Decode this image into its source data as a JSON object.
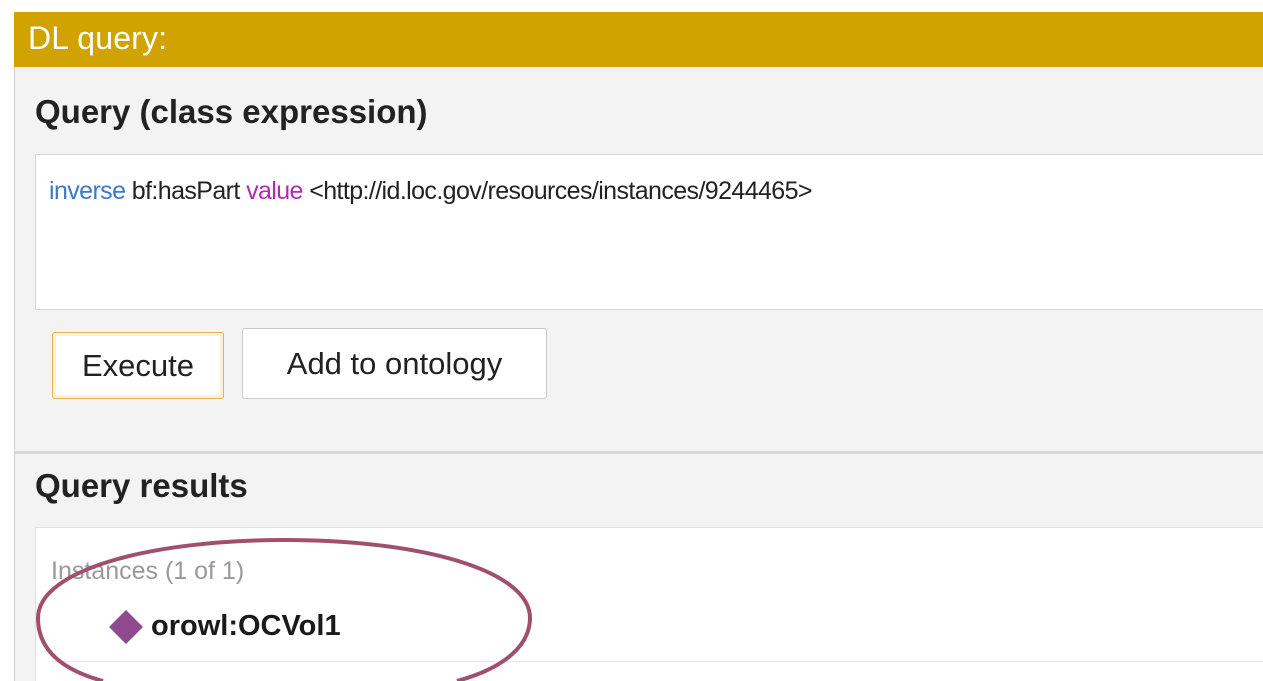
{
  "window": {
    "title": "DL query:"
  },
  "query_section": {
    "title": "Query (class expression)",
    "expression": {
      "keyword1": "inverse",
      "property": "bf:hasPart",
      "keyword2": "value",
      "individual": "<http://id.loc.gov/resources/instances/9244465>"
    }
  },
  "buttons": {
    "execute": "Execute",
    "add_to_ontology": "Add to ontology"
  },
  "results_section": {
    "title": "Query results",
    "instances_label": "Instances (1 of 1)",
    "items": [
      {
        "label": "orowl:OCVol1",
        "icon": "individual-diamond-icon"
      }
    ]
  },
  "colors": {
    "title_bar": "#d1a300",
    "keyword_blue": "#3c79c9",
    "keyword_purple": "#b02bb5",
    "individual_icon": "#8e4a8c",
    "annotation_ellipse": "#a0506e"
  }
}
